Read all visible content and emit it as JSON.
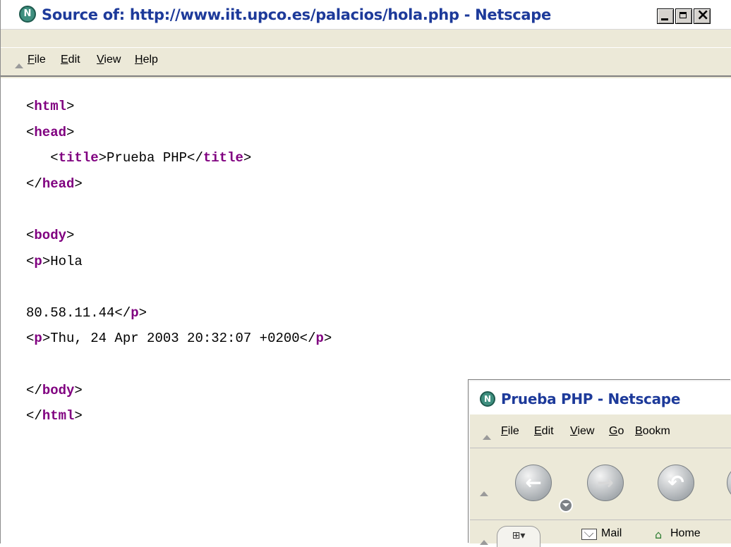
{
  "source_window": {
    "title": "Source of: http://www.iit.upco.es/palacios/hola.php - Netscape",
    "menu": [
      "File",
      "Edit",
      "View",
      "Help"
    ],
    "code_lines": [
      [
        [
          "t",
          "<"
        ],
        [
          "k",
          "html"
        ],
        [
          "t",
          ">"
        ]
      ],
      [
        [
          "t",
          "<"
        ],
        [
          "k",
          "head"
        ],
        [
          "t",
          ">"
        ]
      ],
      [
        [
          "t",
          "   <"
        ],
        [
          "k",
          "title"
        ],
        [
          "t",
          ">Prueba PHP</"
        ],
        [
          "k",
          "title"
        ],
        [
          "t",
          ">"
        ]
      ],
      [
        [
          "t",
          "</"
        ],
        [
          "k",
          "head"
        ],
        [
          "t",
          ">"
        ]
      ],
      [
        [
          "t",
          ""
        ]
      ],
      [
        [
          "t",
          "<"
        ],
        [
          "k",
          "body"
        ],
        [
          "t",
          ">"
        ]
      ],
      [
        [
          "t",
          "<"
        ],
        [
          "k",
          "p"
        ],
        [
          "t",
          ">Hola"
        ]
      ],
      [
        [
          "t",
          ""
        ]
      ],
      [
        [
          "t",
          "80.58.11.44</"
        ],
        [
          "k",
          "p"
        ],
        [
          "t",
          ">"
        ]
      ],
      [
        [
          "t",
          "<"
        ],
        [
          "k",
          "p"
        ],
        [
          "t",
          ">Thu, 24 Apr 2003 20:32:07 +0200</"
        ],
        [
          "k",
          "p"
        ],
        [
          "t",
          ">"
        ]
      ],
      [
        [
          "t",
          ""
        ]
      ],
      [
        [
          "t",
          "</"
        ],
        [
          "k",
          "body"
        ],
        [
          "t",
          ">"
        ]
      ],
      [
        [
          "t",
          "</"
        ],
        [
          "k",
          "html"
        ],
        [
          "t",
          ">"
        ]
      ]
    ],
    "colors": {
      "tag_name": "#800080",
      "title_text": "#1d3a9a"
    }
  },
  "browser_window": {
    "title": "Prueba PHP - Netscape",
    "menu": [
      "File",
      "Edit",
      "View",
      "Go",
      "Bookm"
    ],
    "nav_icons": [
      "back-icon",
      "forward-icon",
      "reload-icon",
      "stop-icon"
    ],
    "personal_toolbar": {
      "mail": "Mail",
      "home": "Home"
    }
  }
}
